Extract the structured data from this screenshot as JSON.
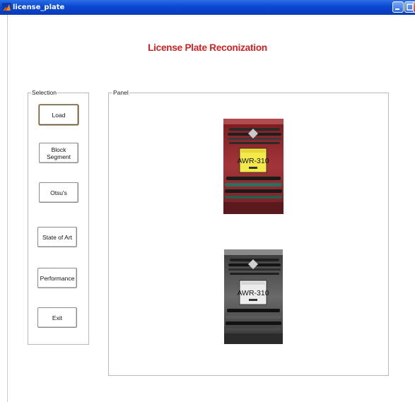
{
  "window": {
    "title": "license_plate"
  },
  "heading": "License Plate Reconization",
  "selection_panel": {
    "legend": "Selection",
    "buttons": {
      "load": "Load",
      "block_segment": "Block Segment",
      "otsus": "Otsu's",
      "state_of_art": "State of Art",
      "performance": "Performance",
      "exit": "Exit"
    }
  },
  "display_panel": {
    "legend": "Panel"
  },
  "images": {
    "color_plate_text": "AWR-310",
    "gray_plate_text": "AWR-310"
  },
  "colors": {
    "title_bar": "#0a47d1",
    "heading": "#d21f1f"
  }
}
